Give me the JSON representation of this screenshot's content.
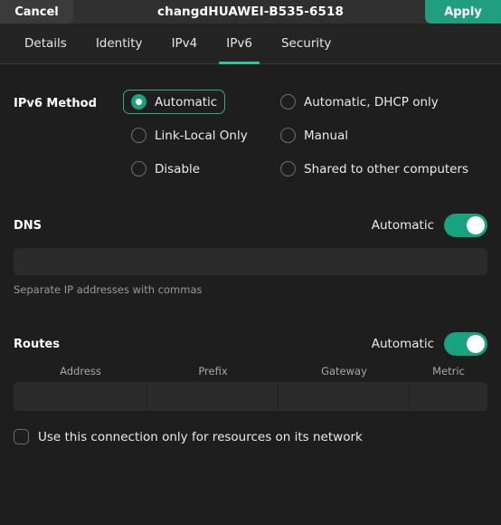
{
  "titlebar": {
    "cancel_label": "Cancel",
    "title": "changdHUAWEI-B535-6518",
    "apply_label": "Apply"
  },
  "tabs": [
    {
      "label": "Details",
      "active": false
    },
    {
      "label": "Identity",
      "active": false
    },
    {
      "label": "IPv4",
      "active": false
    },
    {
      "label": "IPv6",
      "active": true
    },
    {
      "label": "Security",
      "active": false
    }
  ],
  "method": {
    "label": "IPv6 Method",
    "options": [
      {
        "label": "Automatic",
        "checked": true,
        "focused": true
      },
      {
        "label": "Automatic, DHCP only",
        "checked": false,
        "focused": false
      },
      {
        "label": "Link-Local Only",
        "checked": false,
        "focused": false
      },
      {
        "label": "Manual",
        "checked": false,
        "focused": false
      },
      {
        "label": "Disable",
        "checked": false,
        "focused": false
      },
      {
        "label": "Shared to other computers",
        "checked": false,
        "focused": false
      }
    ]
  },
  "dns": {
    "label": "DNS",
    "toggle_label": "Automatic",
    "toggle_on": true,
    "value": "",
    "placeholder": "",
    "helper": "Separate IP addresses with commas"
  },
  "routes": {
    "label": "Routes",
    "toggle_label": "Automatic",
    "toggle_on": true,
    "columns": [
      "Address",
      "Prefix",
      "Gateway",
      "Metric"
    ],
    "rows": [
      {
        "address": "",
        "prefix": "",
        "gateway": "",
        "metric": ""
      }
    ],
    "delete_icon": "trash-icon"
  },
  "restrict": {
    "label": "Use this connection only for resources on its network",
    "checked": false
  },
  "colors": {
    "accent": "#17a37f",
    "accent_bright": "#2ec4a0",
    "window_bg": "#1e1e1e",
    "header_bg": "#303030",
    "tabbar_bg": "#242424",
    "field_bg": "#2b2b2b"
  }
}
